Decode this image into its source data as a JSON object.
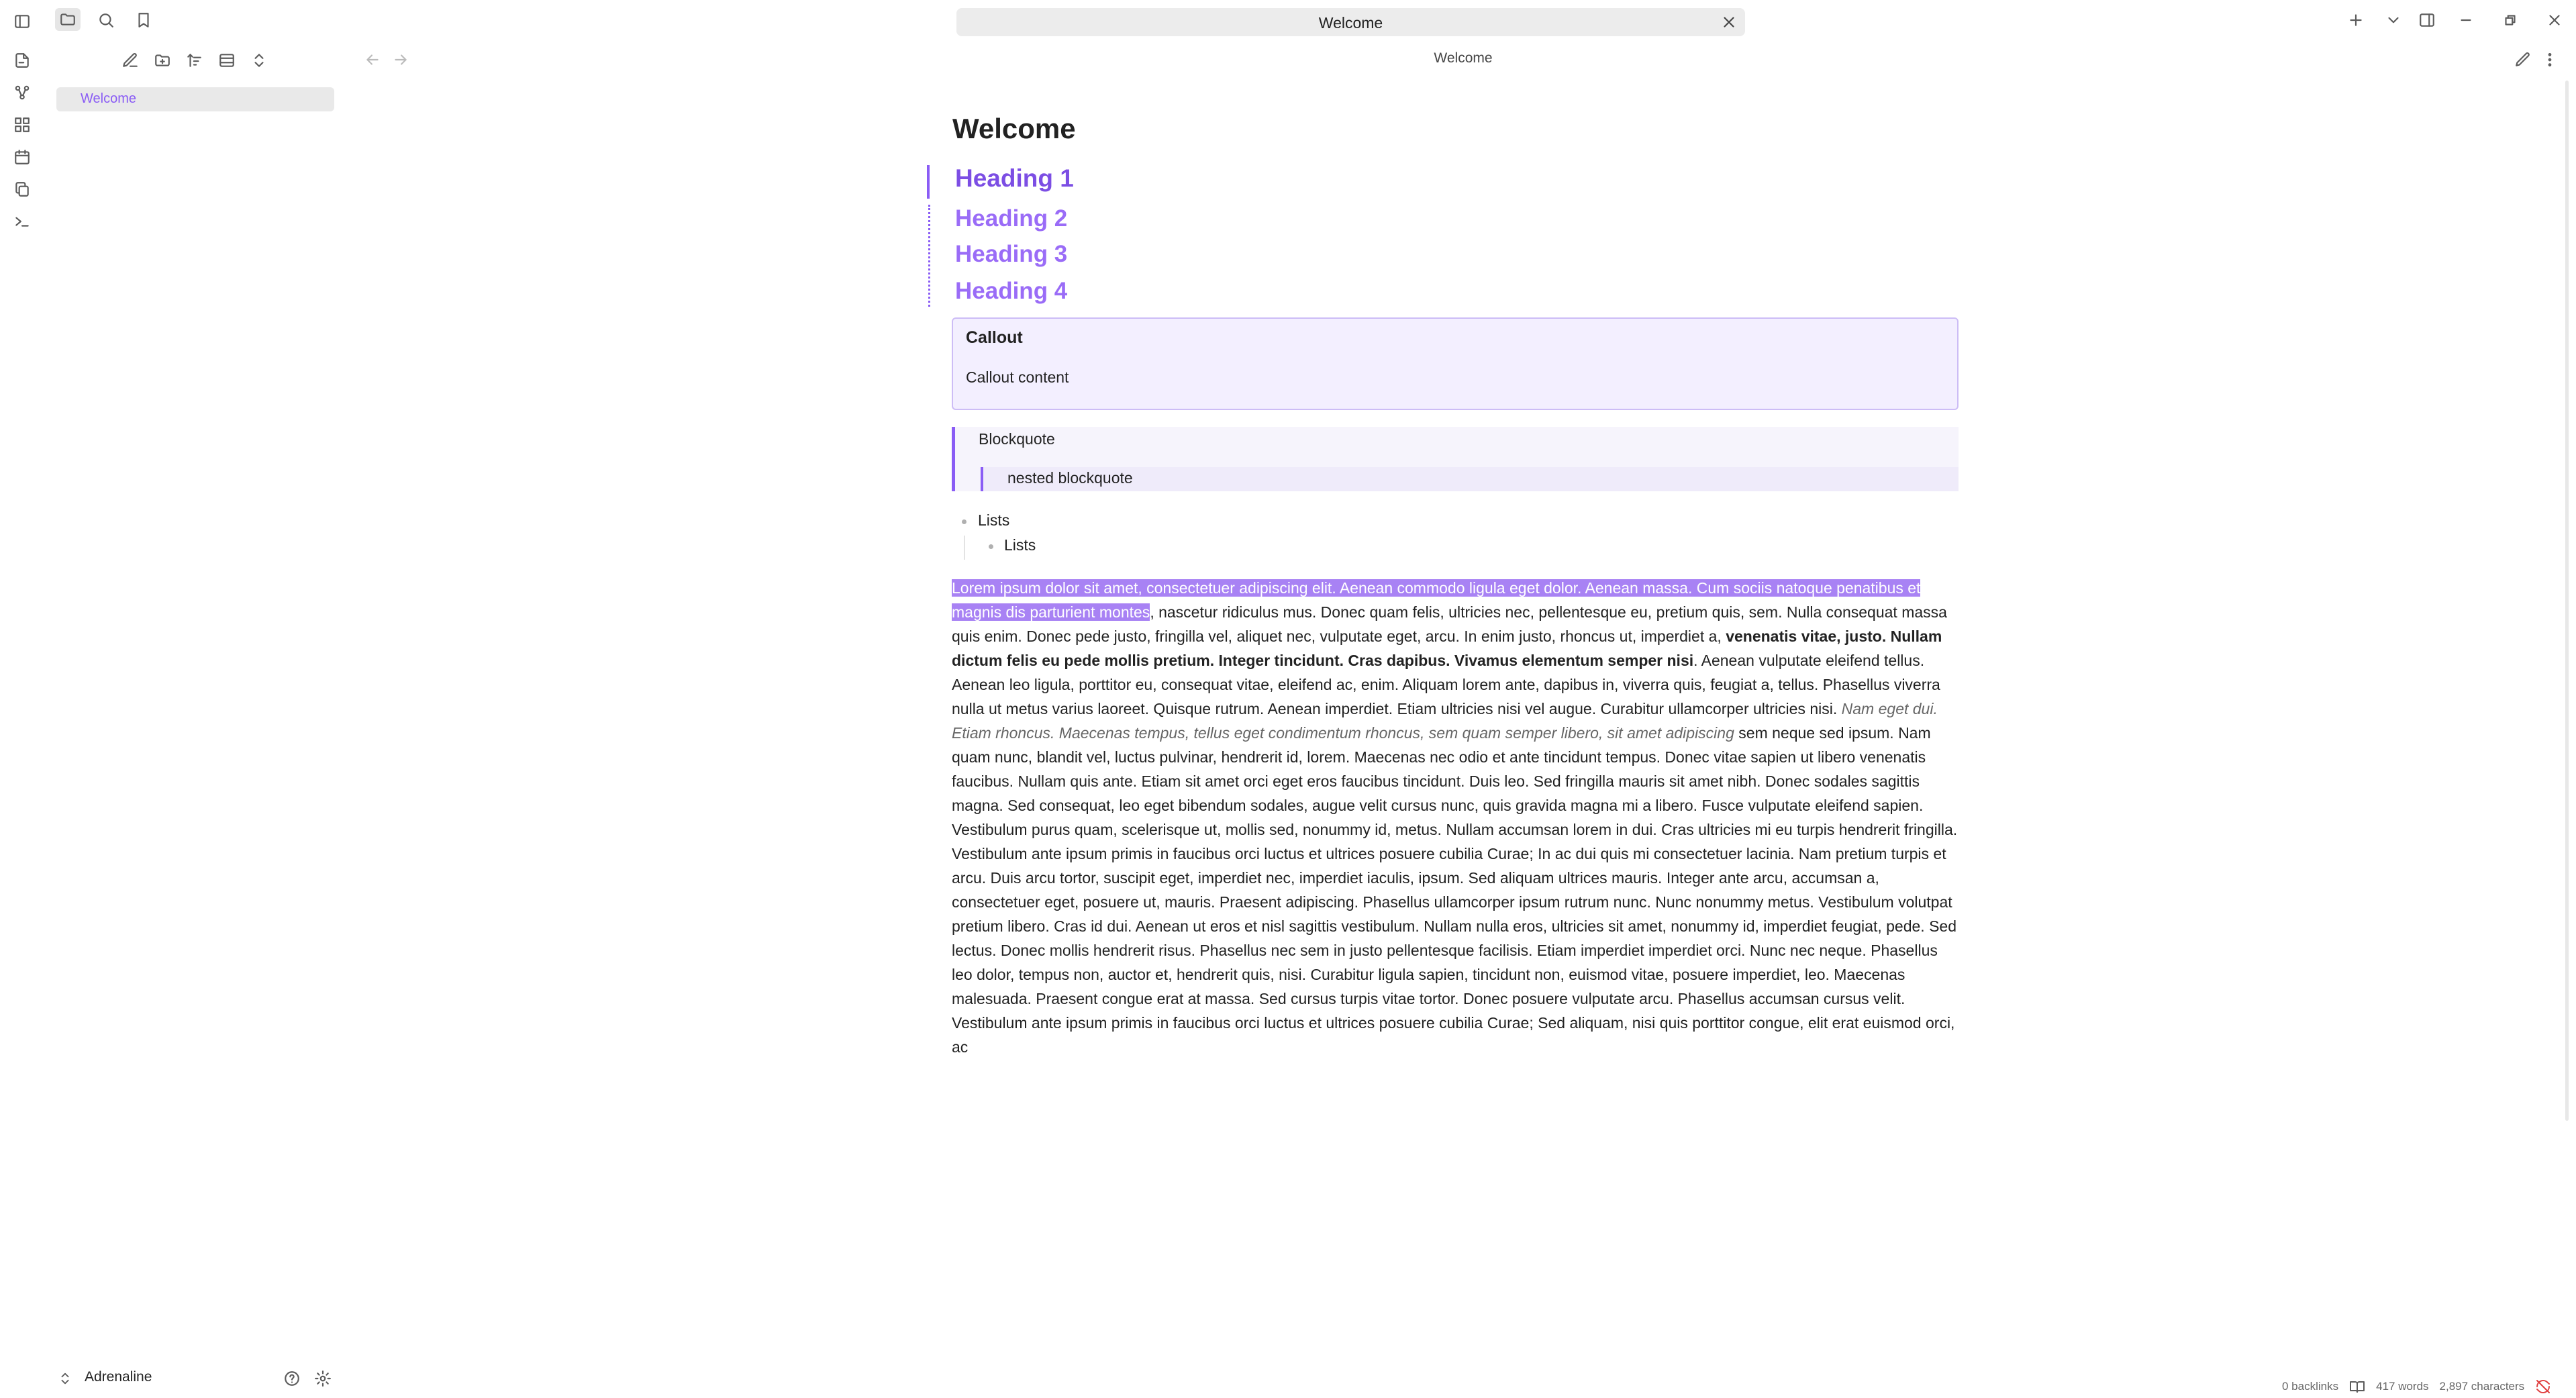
{
  "tab": {
    "title": "Welcome"
  },
  "view": {
    "title": "Welcome"
  },
  "sidebar": {
    "files": [
      {
        "label": "Welcome"
      }
    ],
    "vault_name": "Adrenaline"
  },
  "document": {
    "title": "Welcome",
    "headings": [
      "Heading 1",
      "Heading 2",
      "Heading 3",
      "Heading 4"
    ],
    "callout": {
      "title": "Callout",
      "content": "Callout content"
    },
    "blockquote": {
      "text": "Blockquote",
      "nested": "nested blockquote"
    },
    "lists": [
      "Lists",
      "Lists"
    ],
    "paragraph": {
      "selected": "Lorem ipsum dolor sit amet, consectetuer adipiscing elit. Aenean commodo ligula eget dolor. Aenean massa. Cum sociis natoque penatibus et magnis dis parturient montes",
      "plain1": ", nascetur ridiculus mus. Donec quam felis, ultricies nec, pellentesque eu, pretium quis, sem. Nulla consequat massa quis enim. Donec pede justo, fringilla vel, aliquet nec, vulputate eget, arcu. In enim justo, rhoncus ut, imperdiet a, ",
      "bold": "venenatis vitae, justo. Nullam dictum felis eu pede mollis pretium. Integer tincidunt. Cras dapibus. Vivamus elementum semper nisi",
      "plain2": ". Aenean vulputate eleifend tellus. Aenean leo ligula, porttitor eu, consequat vitae, eleifend ac, enim. Aliquam lorem ante, dapibus in, viverra quis, feugiat a, tellus. Phasellus viverra nulla ut metus varius laoreet. Quisque rutrum. Aenean imperdiet. Etiam ultricies nisi vel augue. Curabitur ullamcorper ultricies nisi. ",
      "italic": "Nam eget dui. Etiam rhoncus. Maecenas tempus, tellus eget condimentum rhoncus, sem quam semper libero, sit amet adipiscing",
      "plain3": " sem neque sed ipsum. Nam quam nunc, blandit vel, luctus pulvinar, hendrerit id, lorem. Maecenas nec odio et ante tincidunt tempus. Donec vitae sapien ut libero venenatis faucibus. Nullam quis ante. Etiam sit amet orci eget eros faucibus tincidunt. Duis leo. Sed fringilla mauris sit amet nibh. Donec sodales sagittis magna. Sed consequat, leo eget bibendum sodales, augue velit cursus nunc, quis gravida magna mi a libero. Fusce vulputate eleifend sapien. Vestibulum purus quam, scelerisque ut, mollis sed, nonummy id, metus. Nullam accumsan lorem in dui. Cras ultricies mi eu turpis hendrerit fringilla. Vestibulum ante ipsum primis in faucibus orci luctus et ultrices posuere cubilia Curae; In ac dui quis mi consectetuer lacinia. Nam pretium turpis et arcu. Duis arcu tortor, suscipit eget, imperdiet nec, imperdiet iaculis, ipsum. Sed aliquam ultrices mauris. Integer ante arcu, accumsan a, consectetuer eget, posuere ut, mauris. Praesent adipiscing. Phasellus ullamcorper ipsum rutrum nunc. Nunc nonummy metus. Vestibulum volutpat pretium libero. Cras id dui. Aenean ut eros et nisl sagittis vestibulum. Nullam nulla eros, ultricies sit amet, nonummy id, imperdiet feugiat, pede. Sed lectus. Donec mollis hendrerit risus. Phasellus nec sem in justo pellentesque facilisis. Etiam imperdiet imperdiet orci. Nunc nec neque. Phasellus leo dolor, tempus non, auctor et, hendrerit quis, nisi. Curabitur ligula sapien, tincidunt non, euismod vitae, posuere imperdiet, leo. Maecenas malesuada. Praesent congue erat at massa. Sed cursus turpis vitae tortor. Donec posuere vulputate arcu. Phasellus accumsan cursus velit. Vestibulum ante ipsum primis in faucibus orci luctus et ultrices posuere cubilia Curae; Sed aliquam, nisi quis porttitor congue, elit erat euismod orci, ac"
    }
  },
  "status_bar": {
    "backlinks": "0 backlinks",
    "words": "417 words",
    "characters": "2,897 characters"
  },
  "colors": {
    "accent": "#8a5cf5",
    "selection": "#a882f4"
  }
}
